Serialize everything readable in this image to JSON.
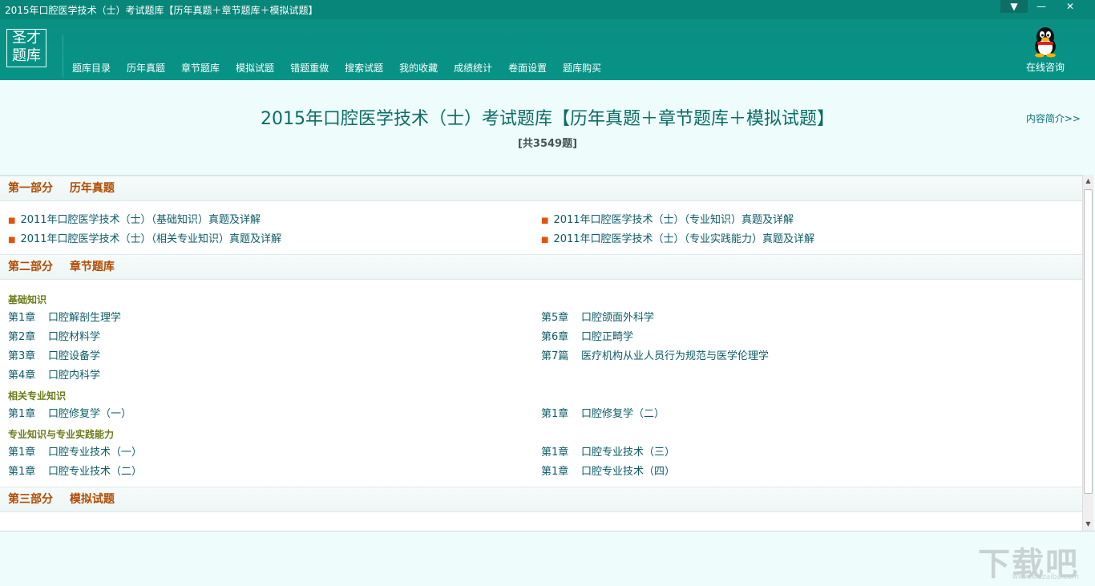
{
  "window": {
    "title": "2015年口腔医学技术（士）考试题库【历年真题＋章节题库＋模拟试题】",
    "buttons": {
      "menu": "▼",
      "minimize": "—",
      "close": "✕"
    }
  },
  "logo": {
    "line1": "圣才",
    "line2": "题库"
  },
  "nav": [
    {
      "label": "题库目录"
    },
    {
      "label": "历年真题"
    },
    {
      "label": "章节题库"
    },
    {
      "label": "模拟试题"
    },
    {
      "label": "错题重做"
    },
    {
      "label": "搜索试题"
    },
    {
      "label": "我的收藏"
    },
    {
      "label": "成绩统计"
    },
    {
      "label": "卷面设置"
    },
    {
      "label": "题库购买"
    }
  ],
  "consult": {
    "label": "在线咨询",
    "icon": "qq-penguin-icon"
  },
  "banner": {
    "title": "2015年口腔医学技术（士）考试题库【历年真题＋章节题库＋模拟试题】",
    "count": "[共3549题]",
    "intro_link": "内容简介>>"
  },
  "sections": {
    "part1": {
      "part": "第一部分",
      "name": "历年真题",
      "links": [
        "2011年口腔医学技术（士）（基础知识）真题及详解",
        "2011年口腔医学技术（士）（专业知识）真题及详解",
        "2011年口腔医学技术（士）（相关专业知识）真题及详解",
        "2011年口腔医学技术（士）（专业实践能力）真题及详解"
      ]
    },
    "part2": {
      "part": "第二部分",
      "name": "章节题库",
      "groups": [
        {
          "title": "基础知识",
          "items": [
            {
              "chap": "第1章",
              "name": "口腔解剖生理学"
            },
            {
              "chap": "第5章",
              "name": "口腔颌面外科学"
            },
            {
              "chap": "第2章",
              "name": "口腔材料学"
            },
            {
              "chap": "第6章",
              "name": "口腔正畸学"
            },
            {
              "chap": "第3章",
              "name": "口腔设备学"
            },
            {
              "chap": "第7篇",
              "name": "医疗机构从业人员行为规范与医学伦理学"
            },
            {
              "chap": "第4章",
              "name": "口腔内科学"
            }
          ]
        },
        {
          "title": "相关专业知识",
          "items": [
            {
              "chap": "第1章",
              "name": "口腔修复学（一）"
            },
            {
              "chap": "第1章",
              "name": "口腔修复学（二）"
            }
          ]
        },
        {
          "title": "专业知识与专业实践能力",
          "items": [
            {
              "chap": "第1章",
              "name": "口腔专业技术（一）"
            },
            {
              "chap": "第1章",
              "name": "口腔专业技术（三）"
            },
            {
              "chap": "第1章",
              "name": "口腔专业技术（二）"
            },
            {
              "chap": "第1章",
              "name": "口腔专业技术（四）"
            }
          ]
        }
      ]
    },
    "part3": {
      "part": "第三部分",
      "name": "模拟试题"
    }
  },
  "watermark": {
    "main": "下载吧",
    "sub": "www.xiazaiba.com"
  },
  "colors": {
    "titlebar": "#08867a",
    "header": "#079386",
    "section_title": "#b24a00",
    "link": "#0c5c68",
    "bullet": "#e0530c"
  }
}
